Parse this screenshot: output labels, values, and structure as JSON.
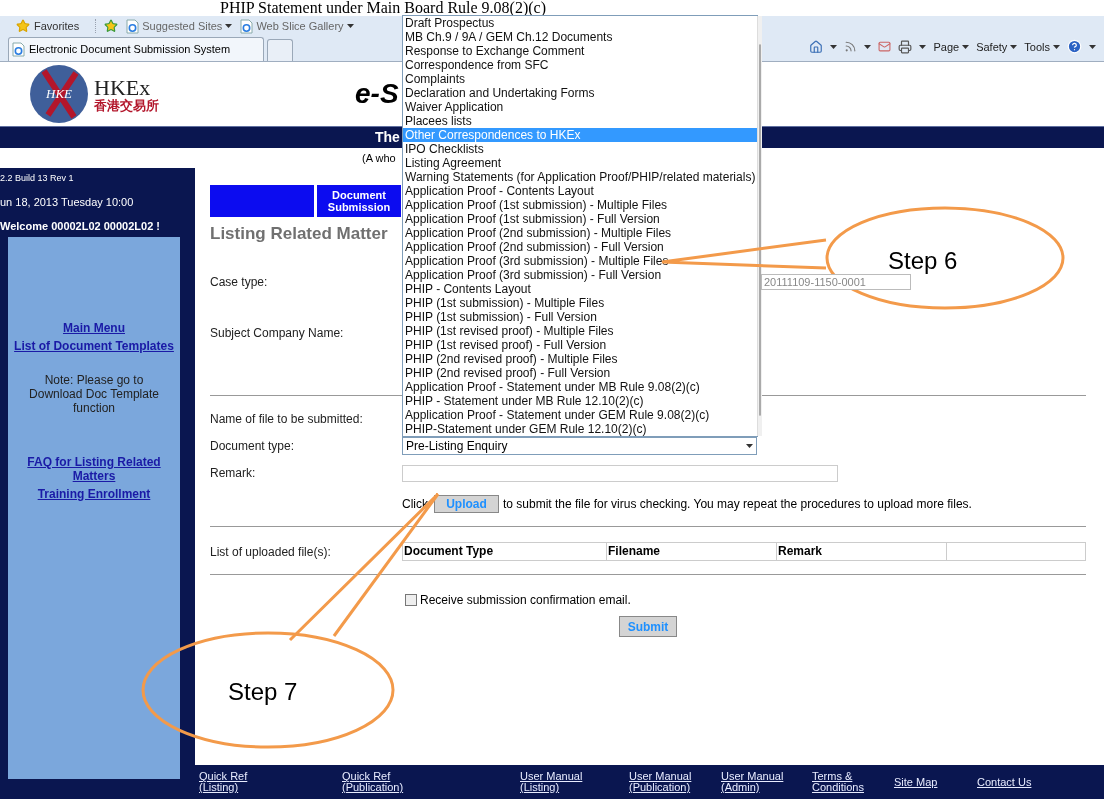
{
  "document_heading": "PHIP Statement under Main Board Rule 9.08(2)(c)",
  "browser": {
    "favorites_label": "Favorites",
    "favorites_links": [
      {
        "label": "Suggested Sites"
      },
      {
        "label": "Web Slice Gallery"
      }
    ],
    "tabs": [
      {
        "label": "Electronic Document Submission System",
        "selected": true
      }
    ],
    "command_menus": [
      {
        "label": "Page"
      },
      {
        "label": "Safety"
      },
      {
        "label": "Tools"
      }
    ]
  },
  "header": {
    "logo_mark": "HKE",
    "logo_name": "HKEx",
    "logo_chinese": "香港交易所",
    "title": "e-S",
    "banner": "The",
    "subtitle": "(A who"
  },
  "sidebar": {
    "version": "2.2 Build 13 Rev 1",
    "date": "un 18, 2013 Tuesday 10:00",
    "welcome": "Welcome  00002L02 00002L02 !",
    "items": [
      {
        "kind": "link",
        "label": "Main Menu"
      },
      {
        "kind": "link",
        "label": "List of Document Templates"
      },
      {
        "kind": "note",
        "label": "Note: Please go to Download Doc Template function"
      },
      {
        "kind": "link",
        "label": "FAQ for Listing Related Matters"
      },
      {
        "kind": "link",
        "label": "Training Enrollment"
      }
    ]
  },
  "form": {
    "nav_tab": "Document Submission",
    "title": "Listing Related Matter",
    "case_type_label": "Case type:",
    "case_number": "20111109-1150-0001",
    "subject_company_label": "Subject Company Name:",
    "file_name_label": "Name of file to be submitted:",
    "document_type_label": "Document type:",
    "document_type_value": "Pre-Listing Enquiry",
    "document_type_options": [
      {
        "label": "Draft Prospectus",
        "selected": false
      },
      {
        "label": "MB Ch.9 / 9A / GEM Ch.12 Documents",
        "selected": false
      },
      {
        "label": "Response to Exchange Comment",
        "selected": false
      },
      {
        "label": "Correspondence from SFC",
        "selected": false
      },
      {
        "label": "Complaints",
        "selected": false
      },
      {
        "label": "Declaration and Undertaking Forms",
        "selected": false
      },
      {
        "label": "Waiver Application",
        "selected": false
      },
      {
        "label": "Placees lists",
        "selected": false
      },
      {
        "label": "Other Correspondences to HKEx",
        "selected": true
      },
      {
        "label": "IPO Checklists",
        "selected": false
      },
      {
        "label": "Listing Agreement",
        "selected": false
      },
      {
        "label": "Warning Statements (for Application Proof/PHIP/related materials)",
        "selected": false
      },
      {
        "label": "Application Proof - Contents Layout",
        "selected": false
      },
      {
        "label": "Application Proof (1st submission) - Multiple Files",
        "selected": false
      },
      {
        "label": "Application Proof (1st submission) - Full Version",
        "selected": false
      },
      {
        "label": "Application Proof (2nd submission) - Multiple Files",
        "selected": false
      },
      {
        "label": "Application Proof (2nd submission) - Full Version",
        "selected": false
      },
      {
        "label": "Application Proof (3rd submission) - Multiple Files",
        "selected": false
      },
      {
        "label": "Application Proof (3rd submission) - Full Version",
        "selected": false
      },
      {
        "label": "PHIP - Contents Layout",
        "selected": false
      },
      {
        "label": "PHIP (1st submission) - Multiple Files",
        "selected": false
      },
      {
        "label": "PHIP (1st submission) - Full Version",
        "selected": false
      },
      {
        "label": "PHIP (1st revised proof) - Multiple Files",
        "selected": false
      },
      {
        "label": "PHIP (1st revised proof) - Full Version",
        "selected": false
      },
      {
        "label": "PHIP (2nd revised proof) - Multiple Files",
        "selected": false
      },
      {
        "label": "PHIP (2nd revised proof) - Full Version",
        "selected": false
      },
      {
        "label": "Application Proof - Statement under MB Rule 9.08(2)(c)",
        "selected": false
      },
      {
        "label": "PHIP - Statement under MB Rule 12.10(2)(c)",
        "selected": false
      },
      {
        "label": "Application Proof - Statement under GEM Rule 9.08(2)(c)",
        "selected": false
      },
      {
        "label": "PHIP-Statement under GEM Rule 12.10(2)(c)",
        "selected": false
      }
    ],
    "remark_label": "Remark:",
    "upload_prefix": "Click",
    "upload_button": "Upload",
    "upload_suffix": "to submit the file for virus checking. You may repeat the procedures to upload more files.",
    "uploaded_label": "List of uploaded file(s):",
    "uploaded_columns": [
      "Document Type",
      "Filename",
      "Remark"
    ],
    "confirmation": {
      "label": "Receive submission confirmation email.",
      "checked": false
    },
    "submit": "Submit"
  },
  "footer_links": [
    {
      "label": "Quick Ref (Listing)"
    },
    {
      "label": "Quick Ref (Publication)"
    },
    {
      "label": "User Manual (Listing)"
    },
    {
      "label": "User Manual (Publication)"
    },
    {
      "label": "User Manual (Admin)"
    },
    {
      "label": "Terms & Conditions"
    },
    {
      "label": "Site Map"
    },
    {
      "label": "Contact Us"
    }
  ],
  "annotations": [
    {
      "label": "Step 6"
    },
    {
      "label": "Step 7"
    }
  ]
}
